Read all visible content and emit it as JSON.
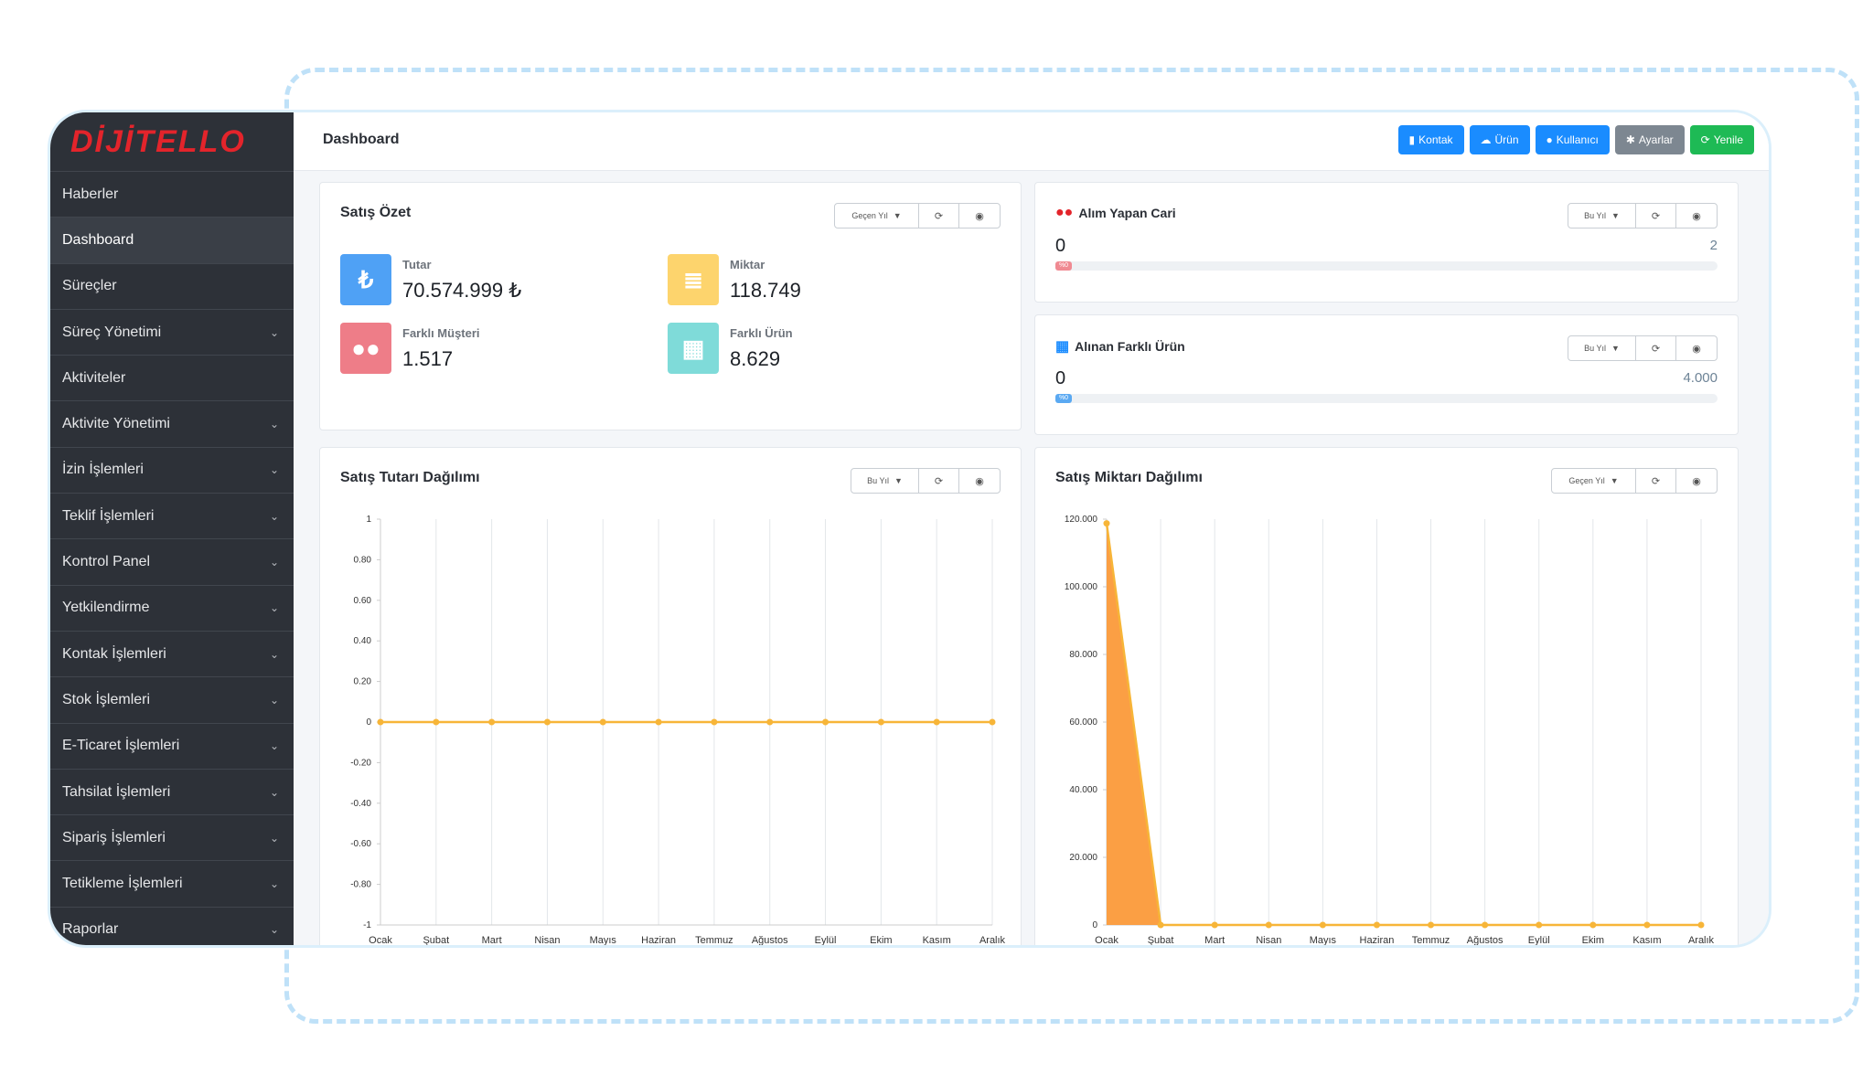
{
  "brand": {
    "logo": "DİJİTELLO"
  },
  "sidebar": {
    "items": [
      {
        "label": "Haberler",
        "chev": false
      },
      {
        "label": "Dashboard",
        "chev": false,
        "active": true
      },
      {
        "label": "Süreçler",
        "chev": false
      },
      {
        "label": "Süreç Yönetimi",
        "chev": true
      },
      {
        "label": "Aktiviteler",
        "chev": false
      },
      {
        "label": "Aktivite Yönetimi",
        "chev": true
      },
      {
        "label": "İzin İşlemleri",
        "chev": true
      },
      {
        "label": "Teklif İşlemleri",
        "chev": true
      },
      {
        "label": "Kontrol Panel",
        "chev": true
      },
      {
        "label": "Yetkilendirme",
        "chev": true
      },
      {
        "label": "Kontak İşlemleri",
        "chev": true
      },
      {
        "label": "Stok İşlemleri",
        "chev": true
      },
      {
        "label": "E-Ticaret İşlemleri",
        "chev": true
      },
      {
        "label": "Tahsilat İşlemleri",
        "chev": true
      },
      {
        "label": "Sipariş İşlemleri",
        "chev": true
      },
      {
        "label": "Tetikleme İşlemleri",
        "chev": true
      },
      {
        "label": "Raporlar",
        "chev": true
      }
    ]
  },
  "header": {
    "title": "Dashboard",
    "buttons": [
      {
        "label": "Kontak",
        "icon": "building-icon",
        "color": "#1a8cff"
      },
      {
        "label": "Ürün",
        "icon": "cubes-icon",
        "color": "#1a8cff"
      },
      {
        "label": "Kullanıcı",
        "icon": "user-icon",
        "color": "#1a8cff"
      },
      {
        "label": "Ayarlar",
        "icon": "gear-icon",
        "color": "#7d8791"
      },
      {
        "label": "Yenile",
        "icon": "refresh-icon",
        "color": "#1eba55"
      }
    ]
  },
  "summary": {
    "title": "Satış Özet",
    "filter": "Geçen Yıl",
    "stats": [
      {
        "label": "Tutar",
        "value": "70.574.999 ₺",
        "color": "#4fa1f5",
        "icon": "lira-icon"
      },
      {
        "label": "Miktar",
        "value": "118.749",
        "color": "#fdd46d",
        "icon": "stack-icon"
      },
      {
        "label": "Farklı Müşteri",
        "value": "1.517",
        "color": "#ee7d88",
        "icon": "users-icon"
      },
      {
        "label": "Farklı Ürün",
        "value": "8.629",
        "color": "#7fdbd9",
        "icon": "qrcode-icon"
      }
    ]
  },
  "buyers": {
    "title": "Alım Yapan Cari",
    "filter": "Bu Yıl",
    "value": "0",
    "target": "2",
    "bar_label": "%0",
    "fraction": 0
  },
  "products": {
    "title": "Alınan Farklı Ürün",
    "filter": "Bu Yıl",
    "value": "0",
    "target": "4.000",
    "bar_label": "%0",
    "fraction": 0
  },
  "amount_chart": {
    "title": "Satış Tutarı Dağılımı",
    "filter": "Bu Yıl"
  },
  "qty_chart": {
    "title": "Satış Miktarı Dağılımı",
    "filter": "Geçen Yıl"
  },
  "chart_data": [
    {
      "type": "line",
      "title": "Satış Tutarı Dağılımı",
      "categories": [
        "Ocak",
        "Şubat",
        "Mart",
        "Nisan",
        "Mayıs",
        "Haziran",
        "Temmuz",
        "Ağustos",
        "Eylül",
        "Ekim",
        "Kasım",
        "Aralık"
      ],
      "series": [
        {
          "values": [
            0,
            0,
            0,
            0,
            0,
            0,
            0,
            0,
            0,
            0,
            0,
            0
          ]
        }
      ],
      "ylim": [
        -1,
        1
      ],
      "yticks": [
        "1",
        "0.80",
        "0.60",
        "0.40",
        "0.20",
        "0",
        "-0.20",
        "-0.40",
        "-0.60",
        "-0.80",
        "-1"
      ],
      "color": "#f7b538",
      "grid": true
    },
    {
      "type": "area",
      "title": "Satış Miktarı Dağılımı",
      "categories": [
        "Ocak",
        "Şubat",
        "Mart",
        "Nisan",
        "Mayıs",
        "Haziran",
        "Temmuz",
        "Ağustos",
        "Eylül",
        "Ekim",
        "Kasım",
        "Aralık"
      ],
      "series": [
        {
          "values": [
            118749,
            0,
            0,
            0,
            0,
            0,
            0,
            0,
            0,
            0,
            0,
            0
          ]
        }
      ],
      "ylim": [
        0,
        120000
      ],
      "yticks": [
        "120.000",
        "100.000",
        "80.000",
        "60.000",
        "40.000",
        "20.000",
        "0"
      ],
      "color": "#fb9a3a",
      "grid": true
    }
  ]
}
